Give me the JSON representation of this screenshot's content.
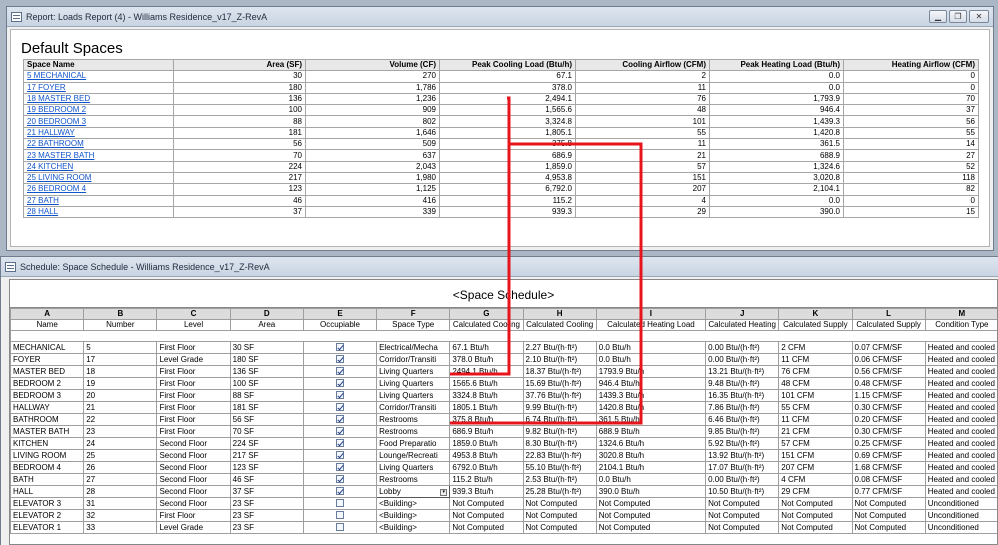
{
  "report": {
    "window_title": "Report: Loads Report (4) - Williams Residence_v17_Z-RevA",
    "heading": "Default Spaces",
    "columns": [
      "Space Name",
      "Area (SF)",
      "Volume (CF)",
      "Peak Cooling Load (Btu/h)",
      "Cooling Airflow (CFM)",
      "Peak Heating Load (Btu/h)",
      "Heating Airflow (CFM)"
    ],
    "rows": [
      [
        "5 MECHANICAL",
        "30",
        "270",
        "67.1",
        "2",
        "0.0",
        "0"
      ],
      [
        "17 FOYER",
        "180",
        "1,786",
        "378.0",
        "11",
        "0.0",
        "0"
      ],
      [
        "18 MASTER BED",
        "136",
        "1,236",
        "2,494.1",
        "76",
        "1,793.9",
        "70"
      ],
      [
        "19 BEDROOM 2",
        "100",
        "909",
        "1,565.6",
        "48",
        "946.4",
        "37"
      ],
      [
        "20 BEDROOM 3",
        "88",
        "802",
        "3,324.8",
        "101",
        "1,439.3",
        "56"
      ],
      [
        "21 HALLWAY",
        "181",
        "1,646",
        "1,805.1",
        "55",
        "1,420.8",
        "55"
      ],
      [
        "22 BATHROOM",
        "56",
        "509",
        "375.8",
        "11",
        "361.5",
        "14"
      ],
      [
        "23 MASTER BATH",
        "70",
        "637",
        "686.9",
        "21",
        "688.9",
        "27"
      ],
      [
        "24 KITCHEN",
        "224",
        "2,043",
        "1,859.0",
        "57",
        "1,324.6",
        "52"
      ],
      [
        "25 LIVING ROOM",
        "217",
        "1,980",
        "4,953.8",
        "151",
        "3,020.8",
        "118"
      ],
      [
        "26 BEDROOM 4",
        "123",
        "1,125",
        "6,792.0",
        "207",
        "2,104.1",
        "82"
      ],
      [
        "27 BATH",
        "46",
        "416",
        "115.2",
        "4",
        "0.0",
        "0"
      ],
      [
        "28 HALL",
        "37",
        "339",
        "939.3",
        "29",
        "390.0",
        "15"
      ]
    ]
  },
  "schedule": {
    "window_title": "Schedule: Space Schedule - Williams Residence_v17_Z-RevA",
    "title": "<Space Schedule>",
    "letters": [
      "A",
      "B",
      "C",
      "D",
      "E",
      "F",
      "G",
      "H",
      "I",
      "J",
      "K",
      "L",
      "M"
    ],
    "headers": [
      "Name",
      "Number",
      "Level",
      "Area",
      "Occupiable",
      "Space Type",
      "Calculated Cooling",
      "Calculated Cooling",
      "Calculated Heating Load",
      "Calculated Heating",
      "Calculated Supply",
      "Calculated Supply",
      "Condition Type"
    ],
    "rows": [
      {
        "cells": [
          "MECHANICAL",
          "5",
          "First Floor",
          "30 SF",
          "",
          "Electrical/Mecha",
          "67.1 Btu/h",
          "2.27 Btu/(h·ft²)",
          "0.0 Btu/h",
          "0.00 Btu/(h·ft²)",
          "2 CFM",
          "0.07 CFM/SF",
          "Heated and cooled"
        ],
        "occupiable": true
      },
      {
        "cells": [
          "FOYER",
          "17",
          "Level Grade",
          "180 SF",
          "",
          "Corridor/Transiti",
          "378.0 Btu/h",
          "2.10 Btu/(h·ft²)",
          "0.0 Btu/h",
          "0.00 Btu/(h·ft²)",
          "11 CFM",
          "0.06 CFM/SF",
          "Heated and cooled"
        ],
        "occupiable": true
      },
      {
        "cells": [
          "MASTER BED",
          "18",
          "First Floor",
          "136 SF",
          "",
          "Living Quarters",
          "2494.1 Btu/h",
          "18.37 Btu/(h·ft²)",
          "1793.9 Btu/h",
          "13.21 Btu/(h·ft²)",
          "76 CFM",
          "0.56 CFM/SF",
          "Heated and cooled"
        ],
        "occupiable": true
      },
      {
        "cells": [
          "BEDROOM 2",
          "19",
          "First Floor",
          "100 SF",
          "",
          "Living Quarters",
          "1565.6 Btu/h",
          "15.69 Btu/(h·ft²)",
          "946.4 Btu/h",
          "9.48 Btu/(h·ft²)",
          "48 CFM",
          "0.48 CFM/SF",
          "Heated and cooled"
        ],
        "occupiable": true
      },
      {
        "cells": [
          "BEDROOM 3",
          "20",
          "First Floor",
          "88 SF",
          "",
          "Living Quarters",
          "3324.8 Btu/h",
          "37.76 Btu/(h·ft²)",
          "1439.3 Btu/h",
          "16.35 Btu/(h·ft²)",
          "101 CFM",
          "1.15 CFM/SF",
          "Heated and cooled"
        ],
        "occupiable": true
      },
      {
        "cells": [
          "HALLWAY",
          "21",
          "First Floor",
          "181 SF",
          "",
          "Corridor/Transiti",
          "1805.1 Btu/h",
          "9.99 Btu/(h·ft²)",
          "1420.8 Btu/h",
          "7.86 Btu/(h·ft²)",
          "55 CFM",
          "0.30 CFM/SF",
          "Heated and cooled"
        ],
        "occupiable": true
      },
      {
        "cells": [
          "BATHROOM",
          "22",
          "First Floor",
          "56 SF",
          "",
          "Restrooms",
          "375.8 Btu/h",
          "6.74 Btu/(h·ft²)",
          "361.5 Btu/h",
          "6.46 Btu/(h·ft²)",
          "11 CFM",
          "0.20 CFM/SF",
          "Heated and cooled"
        ],
        "occupiable": true
      },
      {
        "cells": [
          "MASTER BATH",
          "23",
          "First Floor",
          "70 SF",
          "",
          "Restrooms",
          "686.9 Btu/h",
          "9.82 Btu/(h·ft²)",
          "688.9 Btu/h",
          "9.85 Btu/(h·ft²)",
          "21 CFM",
          "0.30 CFM/SF",
          "Heated and cooled"
        ],
        "occupiable": true
      },
      {
        "cells": [
          "KITCHEN",
          "24",
          "Second Floor",
          "224 SF",
          "",
          "Food Preparatio",
          "1859.0 Btu/h",
          "8.30 Btu/(h·ft²)",
          "1324.6 Btu/h",
          "5.92 Btu/(h·ft²)",
          "57 CFM",
          "0.25 CFM/SF",
          "Heated and cooled"
        ],
        "occupiable": true
      },
      {
        "cells": [
          "LIVING ROOM",
          "25",
          "Second Floor",
          "217 SF",
          "",
          "Lounge/Recreati",
          "4953.8 Btu/h",
          "22.83 Btu/(h·ft²)",
          "3020.8 Btu/h",
          "13.92 Btu/(h·ft²)",
          "151 CFM",
          "0.69 CFM/SF",
          "Heated and cooled"
        ],
        "occupiable": true
      },
      {
        "cells": [
          "BEDROOM 4",
          "26",
          "Second Floor",
          "123 SF",
          "",
          "Living Quarters",
          "6792.0 Btu/h",
          "55.10 Btu/(h·ft²)",
          "2104.1 Btu/h",
          "17.07 Btu/(h·ft²)",
          "207 CFM",
          "1.68 CFM/SF",
          "Heated and cooled"
        ],
        "occupiable": true
      },
      {
        "cells": [
          "BATH",
          "27",
          "Second Floor",
          "46 SF",
          "",
          "Restrooms",
          "115.2 Btu/h",
          "2.53 Btu/(h·ft²)",
          "0.0 Btu/h",
          "0.00 Btu/(h·ft²)",
          "4 CFM",
          "0.08 CFM/SF",
          "Heated and cooled"
        ],
        "occupiable": true
      },
      {
        "cells": [
          "HALL",
          "28",
          "Second Floor",
          "37 SF",
          "",
          "Lobby",
          "939.3 Btu/h",
          "25.28 Btu/(h·ft²)",
          "390.0 Btu/h",
          "10.50 Btu/(h·ft²)",
          "29 CFM",
          "0.77 CFM/SF",
          "Heated and cooled"
        ],
        "occupiable": true,
        "editing": true
      },
      {
        "cells": [
          "ELEVATOR 3",
          "31",
          "Second Floor",
          "23 SF",
          "",
          "<Building>",
          "Not Computed",
          "Not Computed",
          "Not Computed",
          "Not Computed",
          "Not Computed",
          "Not Computed",
          "Unconditioned"
        ],
        "occupiable": false
      },
      {
        "cells": [
          "ELEVATOR 2",
          "32",
          "First Floor",
          "23 SF",
          "",
          "<Building>",
          "Not Computed",
          "Not Computed",
          "Not Computed",
          "Not Computed",
          "Not Computed",
          "Not Computed",
          "Unconditioned"
        ],
        "occupiable": false
      },
      {
        "cells": [
          "ELEVATOR 1",
          "33",
          "Level Grade",
          "23 SF",
          "",
          "<Building>",
          "Not Computed",
          "Not Computed",
          "Not Computed",
          "Not Computed",
          "Not Computed",
          "Not Computed",
          "Unconditioned"
        ],
        "occupiable": false
      }
    ]
  },
  "annotation": {
    "line_color": "#e8141c"
  }
}
